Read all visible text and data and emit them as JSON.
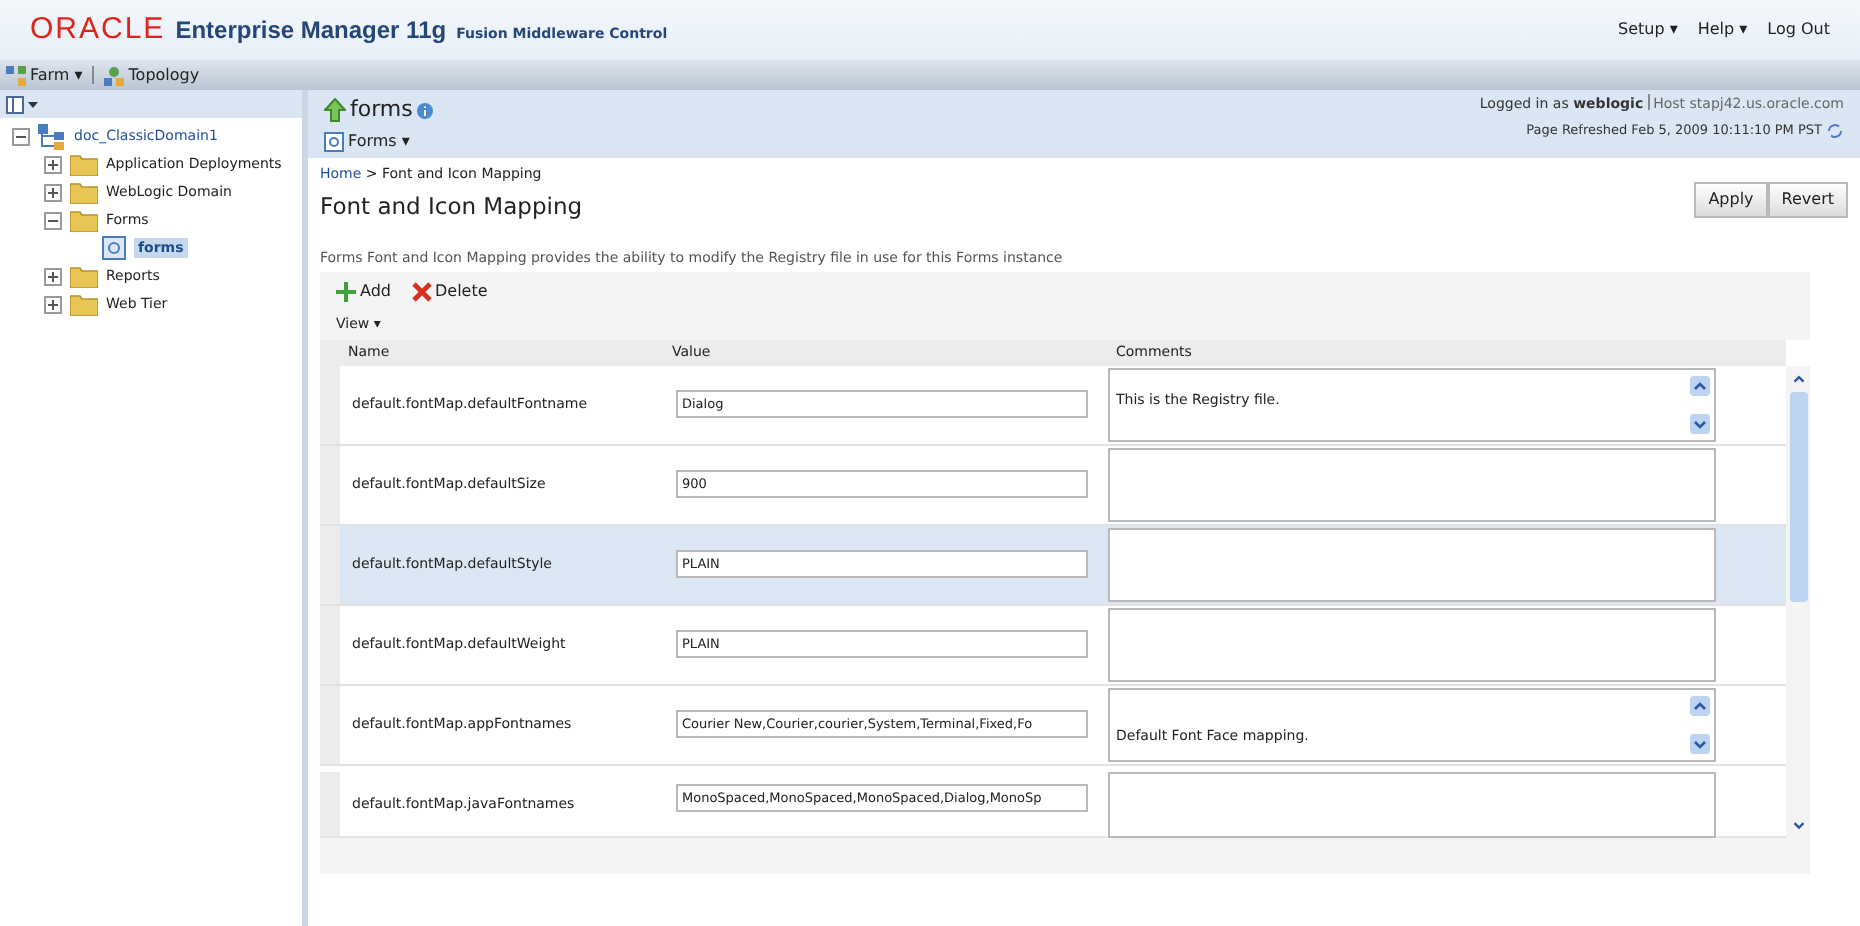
{
  "header": {
    "logo": "ORACLE",
    "product": "Enterprise Manager 11g",
    "subtitle": "Fusion Middleware Control",
    "links": [
      "Setup ▾",
      "Help ▾",
      "Log Out"
    ]
  },
  "toolbar": {
    "items": [
      "Farm ▾",
      "Topology"
    ]
  },
  "sidebar": {
    "items": [
      {
        "label": "doc_ClassicDomain1",
        "expanded": true,
        "selected": false,
        "children": [
          {
            "label": "Application Deployments",
            "expanded": false,
            "selected": false
          },
          {
            "label": "WebLogic Domain",
            "expanded": false,
            "selected": false
          },
          {
            "label": "Forms",
            "expanded": true,
            "selected": false,
            "children": [
              {
                "label": "forms",
                "selected": true
              }
            ]
          },
          {
            "label": "Reports",
            "expanded": false,
            "selected": false
          },
          {
            "label": "Web Tier",
            "expanded": false,
            "selected": false
          }
        ]
      }
    ]
  },
  "target": {
    "title": "forms",
    "menu": "Forms ▾",
    "logged_in_prefix": "Logged in as ",
    "user": "weblogic",
    "host": "Host stapj42.us.oracle.com",
    "refreshed": "Page Refreshed Feb 5, 2009 10:11:10 PM PST"
  },
  "page": {
    "breadcrumb_home": "Home",
    "breadcrumb_rest": " > Font and Icon Mapping",
    "title": "Font and Icon Mapping",
    "buttons": [
      "Apply",
      "Revert"
    ],
    "description": "Forms Font and Icon Mapping provides the ability to modify the Registry file in use for this Forms instance"
  },
  "table": {
    "actions": [
      "Add",
      "Delete"
    ],
    "view_menu": "View ▾",
    "columns": [
      "Name",
      "Value",
      "Comments"
    ],
    "rows": [
      {
        "name": "default.fontMap.defaultFontname",
        "value": "Dialog",
        "comment": "This is the Registry file.",
        "comment_scroll": true,
        "selected": false
      },
      {
        "name": "default.fontMap.defaultSize",
        "value": "900",
        "comment_scroll": false,
        "selected": false
      },
      {
        "name": "default.fontMap.defaultStyle",
        "value": "PLAIN",
        "comment_scroll": false,
        "selected": true
      },
      {
        "name": "default.fontMap.defaultWeight",
        "value": "PLAIN",
        "comment_scroll": false,
        "selected": false
      },
      {
        "name": "default.fontMap.appFontnames",
        "value": "Courier New,Courier,courier,System,Terminal,Fixed,Fo",
        "comment": "Default Font Face mapping.",
        "comment_scroll": true,
        "selected": false
      },
      {
        "name": "default.fontMap.javaFontnames",
        "value": "MonoSpaced,MonoSpaced,MonoSpaced,Dialog,MonoSp",
        "comment_scroll": false,
        "selected": false
      }
    ]
  }
}
